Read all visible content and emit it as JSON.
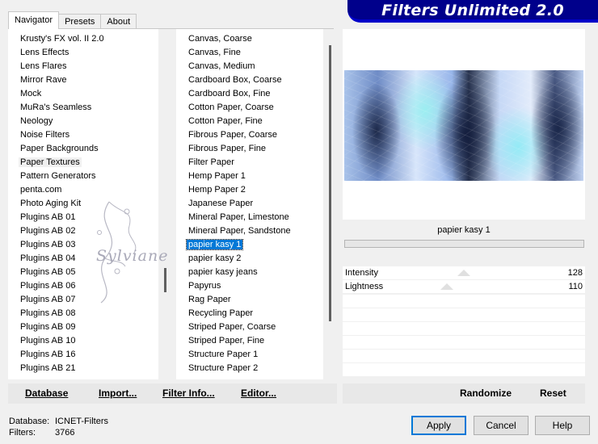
{
  "app": {
    "title": "Filters Unlimited 2.0"
  },
  "tabs": [
    {
      "label": "Navigator",
      "active": true
    },
    {
      "label": "Presets",
      "active": false
    },
    {
      "label": "About",
      "active": false
    }
  ],
  "categories": {
    "selected": "Paper Textures",
    "items": [
      "Krusty's FX vol. II 2.0",
      "Lens Effects",
      "Lens Flares",
      "Mirror Rave",
      "Mock",
      "MuRa's Seamless",
      "Neology",
      "Noise Filters",
      "Paper Backgrounds",
      "Paper Textures",
      "Pattern Generators",
      "penta.com",
      "Photo Aging Kit",
      "Plugins AB 01",
      "Plugins AB 02",
      "Plugins AB 03",
      "Plugins AB 04",
      "Plugins AB 05",
      "Plugins AB 06",
      "Plugins AB 07",
      "Plugins AB 08",
      "Plugins AB 09",
      "Plugins AB 10",
      "Plugins AB 16",
      "Plugins AB 21"
    ]
  },
  "filters": {
    "selected": "papier kasy 1",
    "items": [
      "Canvas, Coarse",
      "Canvas, Fine",
      "Canvas, Medium",
      "Cardboard Box, Coarse",
      "Cardboard Box, Fine",
      "Cotton Paper, Coarse",
      "Cotton Paper, Fine",
      "Fibrous Paper, Coarse",
      "Fibrous Paper, Fine",
      "Filter Paper",
      "Hemp Paper 1",
      "Hemp Paper 2",
      "Japanese Paper",
      "Mineral Paper, Limestone",
      "Mineral Paper, Sandstone",
      "papier kasy 1",
      "papier kasy 2",
      "papier kasy jeans",
      "Papyrus",
      "Rag Paper",
      "Recycling Paper",
      "Striped Paper, Coarse",
      "Striped Paper, Fine",
      "Structure Paper 1",
      "Structure Paper 2"
    ]
  },
  "watermark": {
    "text": "Sylviane"
  },
  "preview": {
    "filter_name": "papier kasy 1"
  },
  "params": [
    {
      "label": "Intensity",
      "value": "128"
    },
    {
      "label": "Lightness",
      "value": "110"
    }
  ],
  "toolbar": {
    "database": "Database",
    "import": "Import...",
    "filter_info": "Filter Info...",
    "editor": "Editor...",
    "randomize": "Randomize",
    "reset": "Reset"
  },
  "status": {
    "database_label": "Database:",
    "database_value": "ICNET-Filters",
    "filters_label": "Filters:",
    "filters_value": "3766"
  },
  "buttons": {
    "apply": "Apply",
    "cancel": "Cancel",
    "help": "Help"
  }
}
